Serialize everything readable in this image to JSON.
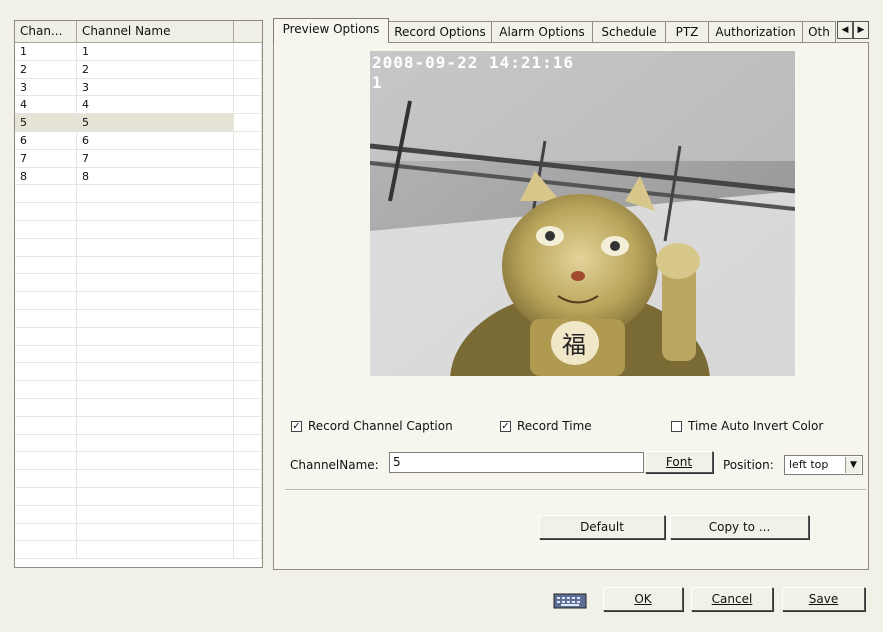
{
  "channel_list": {
    "headers": [
      "Chan...",
      "Channel Name",
      ""
    ],
    "rows": [
      {
        "num": "1",
        "name": "1"
      },
      {
        "num": "2",
        "name": "2"
      },
      {
        "num": "3",
        "name": "3"
      },
      {
        "num": "4",
        "name": "4"
      },
      {
        "num": "5",
        "name": "5"
      },
      {
        "num": "6",
        "name": "6"
      },
      {
        "num": "7",
        "name": "7"
      },
      {
        "num": "8",
        "name": "8"
      }
    ],
    "selected": "5"
  },
  "tabs": [
    "Preview Options",
    "Record Options",
    "Alarm Options",
    "Schedule",
    "PTZ",
    "Authorization",
    "Oth"
  ],
  "active_tab": "Preview Options",
  "preview": {
    "osd_time": "2008-09-22 14:21:16",
    "osd_channel": "1"
  },
  "options": {
    "record_channel_caption": {
      "label": "Record Channel Caption",
      "checked": true
    },
    "record_time": {
      "label": "Record Time",
      "checked": true
    },
    "time_auto_invert": {
      "label": "Time Auto Invert Color",
      "checked": false
    }
  },
  "channel_name": {
    "label": "ChannelName:",
    "value": "5"
  },
  "font_button": "Font",
  "position": {
    "label": "Position:",
    "value": "left top"
  },
  "buttons": {
    "default": "Default",
    "copy_to": "Copy to ...",
    "ok": "OK",
    "cancel": "Cancel",
    "save": "Save"
  },
  "icons": {
    "keyboard": "keyboard-icon",
    "tab_left": "arrow-left-icon",
    "tab_right": "arrow-right-icon",
    "dropdown": "chevron-down-icon",
    "check": "checkmark-icon"
  }
}
